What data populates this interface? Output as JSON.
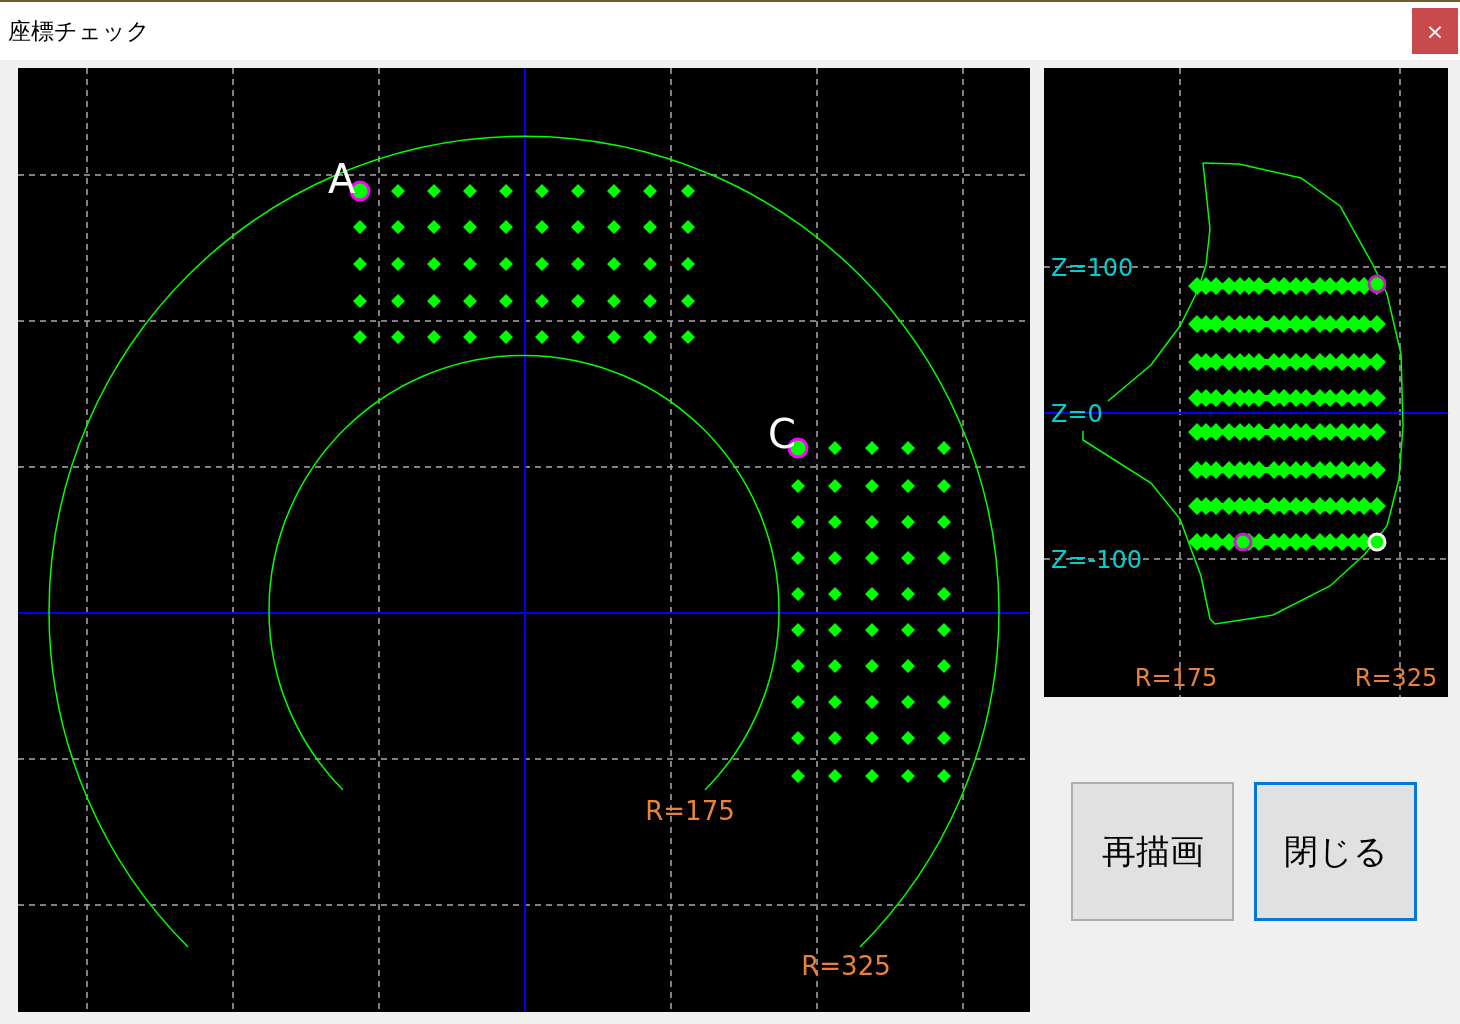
{
  "window": {
    "title": "座標チェック",
    "close": "×"
  },
  "plan_view": {
    "point_labels": [
      "A",
      "C"
    ],
    "radius_labels": [
      "R=175",
      "R=325"
    ]
  },
  "side_view": {
    "z_labels": [
      "Z=100",
      "Z=0",
      "Z=-100"
    ],
    "r_labels": [
      "R=175",
      "R=325"
    ]
  },
  "buttons": [
    {
      "label": "再描画",
      "focused": false
    },
    {
      "label": "閉じる",
      "focused": true
    }
  ]
}
